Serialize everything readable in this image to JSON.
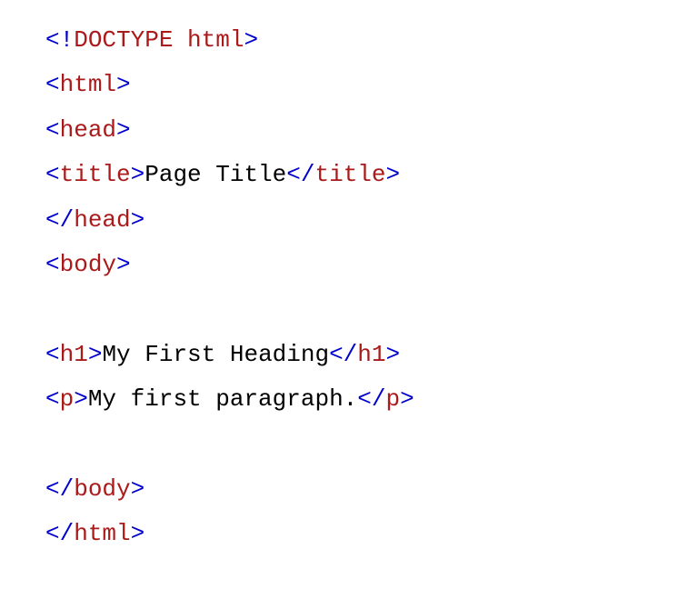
{
  "code": {
    "lines": [
      {
        "segments": [
          {
            "t": "<!",
            "c": "bracket"
          },
          {
            "t": "DOCTYPE",
            "c": "tag"
          },
          {
            "t": " ",
            "c": "bracket"
          },
          {
            "t": "html",
            "c": "tag"
          },
          {
            "t": ">",
            "c": "bracket"
          }
        ]
      },
      {
        "segments": [
          {
            "t": "<",
            "c": "bracket"
          },
          {
            "t": "html",
            "c": "tag"
          },
          {
            "t": ">",
            "c": "bracket"
          }
        ]
      },
      {
        "segments": [
          {
            "t": "<",
            "c": "bracket"
          },
          {
            "t": "head",
            "c": "tag"
          },
          {
            "t": ">",
            "c": "bracket"
          }
        ]
      },
      {
        "segments": [
          {
            "t": "<",
            "c": "bracket"
          },
          {
            "t": "title",
            "c": "tag"
          },
          {
            "t": ">",
            "c": "bracket"
          },
          {
            "t": "Page Title",
            "c": "text"
          },
          {
            "t": "</",
            "c": "bracket"
          },
          {
            "t": "title",
            "c": "tag"
          },
          {
            "t": ">",
            "c": "bracket"
          }
        ]
      },
      {
        "segments": [
          {
            "t": "</",
            "c": "bracket"
          },
          {
            "t": "head",
            "c": "tag"
          },
          {
            "t": ">",
            "c": "bracket"
          }
        ]
      },
      {
        "segments": [
          {
            "t": "<",
            "c": "bracket"
          },
          {
            "t": "body",
            "c": "tag"
          },
          {
            "t": ">",
            "c": "bracket"
          }
        ]
      },
      {
        "segments": [
          {
            "t": " ",
            "c": "text"
          }
        ]
      },
      {
        "segments": [
          {
            "t": "<",
            "c": "bracket"
          },
          {
            "t": "h1",
            "c": "tag"
          },
          {
            "t": ">",
            "c": "bracket"
          },
          {
            "t": "My First Heading",
            "c": "text"
          },
          {
            "t": "</",
            "c": "bracket"
          },
          {
            "t": "h1",
            "c": "tag"
          },
          {
            "t": ">",
            "c": "bracket"
          }
        ]
      },
      {
        "segments": [
          {
            "t": "<",
            "c": "bracket"
          },
          {
            "t": "p",
            "c": "tag"
          },
          {
            "t": ">",
            "c": "bracket"
          },
          {
            "t": "My first paragraph.",
            "c": "text"
          },
          {
            "t": "</",
            "c": "bracket"
          },
          {
            "t": "p",
            "c": "tag"
          },
          {
            "t": ">",
            "c": "bracket"
          }
        ]
      },
      {
        "segments": [
          {
            "t": " ",
            "c": "text"
          }
        ]
      },
      {
        "segments": [
          {
            "t": "</",
            "c": "bracket"
          },
          {
            "t": "body",
            "c": "tag"
          },
          {
            "t": ">",
            "c": "bracket"
          }
        ]
      },
      {
        "segments": [
          {
            "t": "</",
            "c": "bracket"
          },
          {
            "t": "html",
            "c": "tag"
          },
          {
            "t": ">",
            "c": "bracket"
          }
        ]
      }
    ]
  }
}
